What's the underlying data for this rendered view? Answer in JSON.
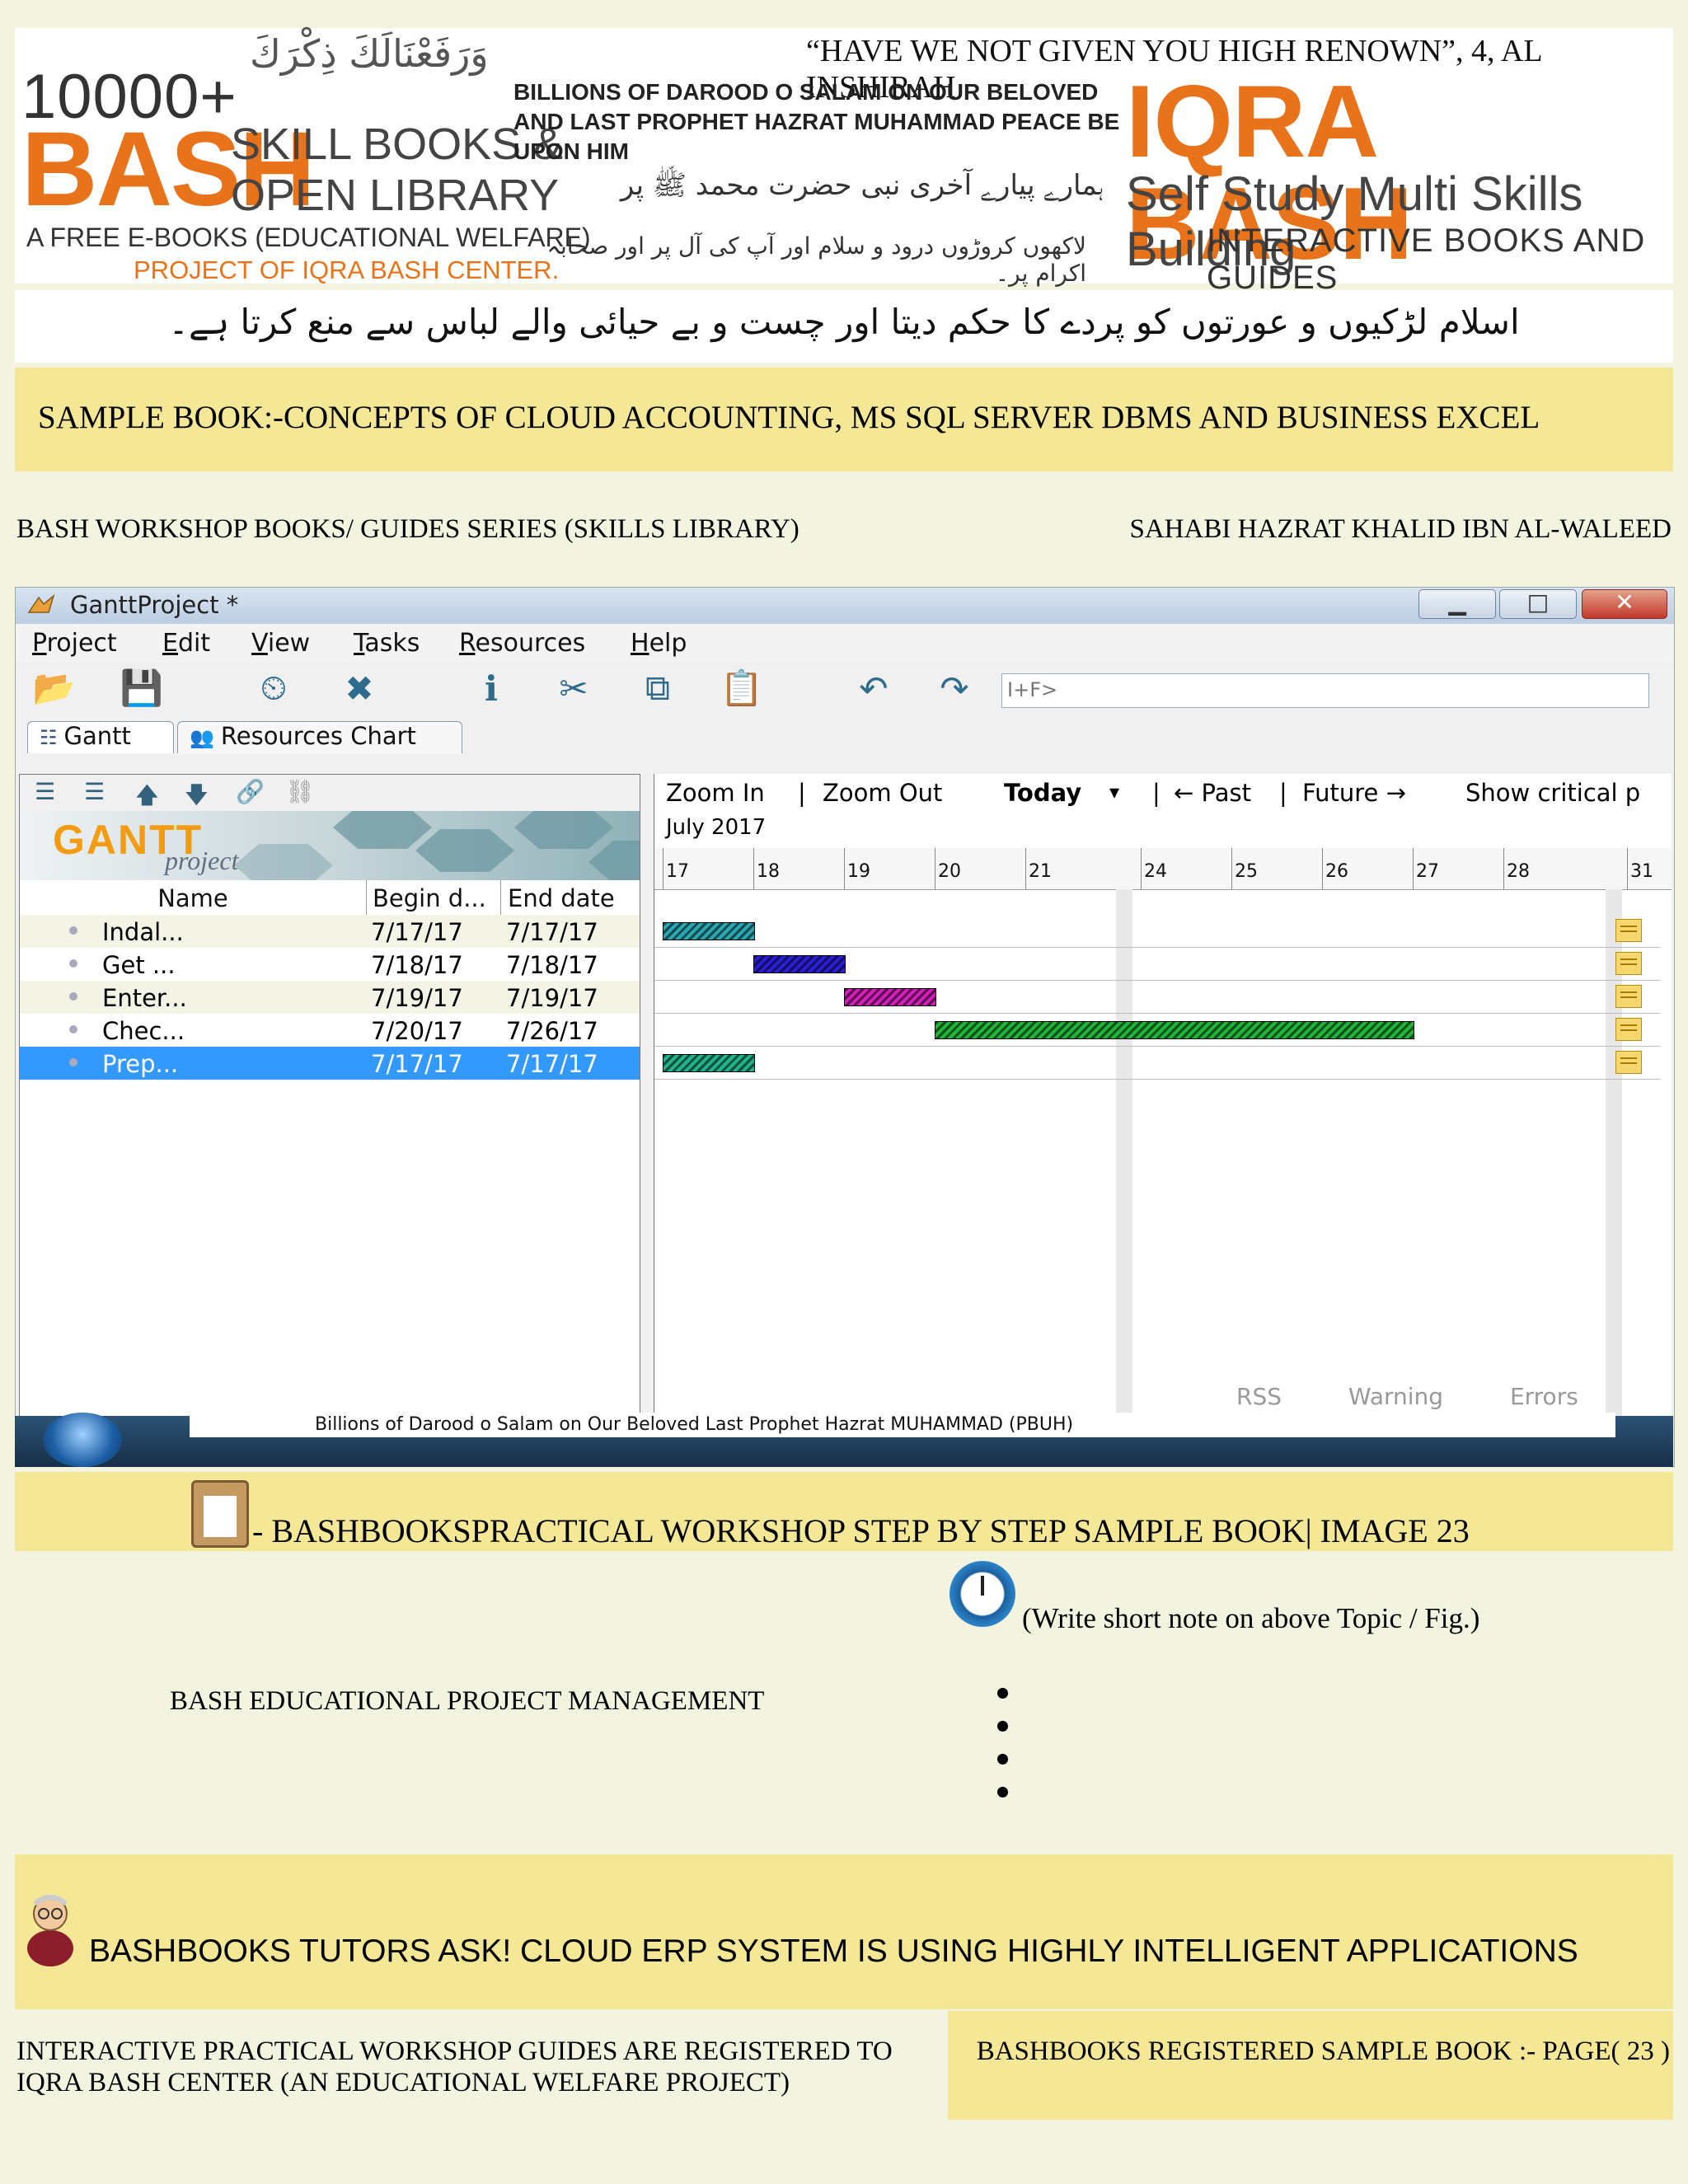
{
  "banner": {
    "arabic": "وَرَفَعْنَالَكَ ذِكْرَكَ",
    "count": "10000+",
    "bash": "BASH",
    "skill_books": "SKILL BOOKS &",
    "open_library": "OPEN LIBRARY",
    "free_ebooks": "A FREE E-BOOKS (EDUCATIONAL WELFARE)",
    "project_of": "PROJECT OF IQRA BASH CENTER.",
    "quote": "“HAVE WE NOT GIVEN YOU HIGH RENOWN”, 4, AL INSHIRAH",
    "darood": "BILLIONS OF DAROOD O SALAM ON OUR BELOVED AND LAST PROPHET HAZRAT MUHAMMAD PEACE BE UPON HIM",
    "urdu_line1": "ہمارے پیارے آخری نبی حضرت محمد ﷺ پر",
    "urdu_line2": "لاکھوں کروڑوں درود و سلام اور آپ کی آل پر اور صحابہ اکرام پر۔",
    "iqra_bash": "IQRA BASH",
    "self_study": "Self Study Multi Skills Building",
    "interactive": "INTERACTIVE BOOKS AND GUIDES",
    "urdu_band": "اسلام لڑکیوں و عورتوں کو پردے کا حکم دیتا اور چست و بے حیائی والے لباس سے منع کرتا ہے۔"
  },
  "title": "SAMPLE BOOK:-CONCEPTS OF CLOUD ACCOUNTING, MS SQL SERVER DBMS AND BUSINESS EXCEL",
  "series": "BASH WORKSHOP BOOKS/ GUIDES SERIES (SKILLS LIBRARY)",
  "sahabi": "SAHABI HAZRAT KHALID IBN AL-WALEED",
  "app": {
    "window_title": "GanttProject *",
    "menu": [
      "Project",
      "Edit",
      "View",
      "Tasks",
      "Resources",
      "Help"
    ],
    "search_placeholder": "I+F>",
    "tabs": {
      "gantt": "Gantt",
      "resources": "Resources Chart"
    },
    "logo_gantt": "GANTT",
    "logo_project": "project",
    "columns": {
      "name": "Name",
      "begin": "Begin d...",
      "end": "End date"
    },
    "tasks": [
      {
        "name": "Indal...",
        "begin": "7/17/17",
        "end": "7/17/17",
        "color": "#2aa7b0",
        "start_day": 17,
        "end_day": 17,
        "selected": false
      },
      {
        "name": "Get ...",
        "begin": "7/18/17",
        "end": "7/18/17",
        "color": "#2b1fd6",
        "start_day": 18,
        "end_day": 18,
        "selected": false
      },
      {
        "name": "Enter...",
        "begin": "7/19/17",
        "end": "7/19/17",
        "color": "#d020b8",
        "start_day": 19,
        "end_day": 19,
        "selected": false
      },
      {
        "name": "Chec...",
        "begin": "7/20/17",
        "end": "7/26/17",
        "color": "#22b33a",
        "start_day": 20,
        "end_day": 26,
        "selected": false
      },
      {
        "name": "Prep...",
        "begin": "7/17/17",
        "end": "7/17/17",
        "color": "#22b38a",
        "start_day": 17,
        "end_day": 17,
        "selected": true
      }
    ],
    "chart_toolbar": {
      "zoom_in": "Zoom In",
      "sep1": "|",
      "zoom_out": "Zoom Out",
      "today": "Today",
      "today_arrow": "▾",
      "sep2": "|",
      "past": "← Past",
      "sep3": "|",
      "future": "Future →",
      "critical": "Show critical p"
    },
    "month": "July 2017",
    "day_ticks": [
      "17",
      "18",
      "19",
      "20",
      "21",
      "24",
      "25",
      "26",
      "27",
      "28",
      "31"
    ],
    "status": {
      "rss": "RSS",
      "warning": "Warning",
      "errors": "Errors"
    },
    "taskbar_text": "Billions of Darood o Salam on Our Beloved Last Prophet Hazrat MUHAMMAD (PBUH)"
  },
  "caption": "- BASHBOOKSPRACTICAL WORKSHOP STEP BY STEP SAMPLE BOOK| IMAGE 23",
  "note": "(Write short note on above Topic / Fig.)",
  "management": "BASH EDUCATIONAL PROJECT MANAGEMENT",
  "ask": "BASHBOOKS TUTORS ASK! CLOUD ERP SYSTEM IS USING HIGHLY INTELLIGENT APPLICATIONS",
  "footer_left": "INTERACTIVE PRACTICAL WORKSHOP GUIDES ARE REGISTERED TO IQRA BASH CENTER (AN EDUCATIONAL WELFARE PROJECT)",
  "footer_right": "BASHBOOKS REGISTERED SAMPLE BOOK :- PAGE( 23 )"
}
